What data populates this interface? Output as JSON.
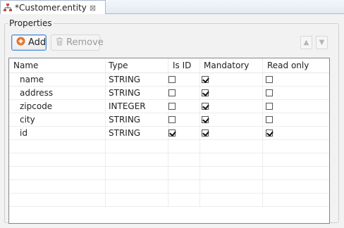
{
  "tab": {
    "title": "*Customer.entity",
    "icon": "entity-tree-icon",
    "close_glyph": "⊠"
  },
  "group": {
    "label": "Properties"
  },
  "toolbar": {
    "add_label": "Add",
    "remove_label": "Remove",
    "move_up_glyph": "▲",
    "move_down_glyph": "▼"
  },
  "table": {
    "columns": [
      "Name",
      "Type",
      "Is ID",
      "Mandatory",
      "Read only"
    ],
    "rows": [
      {
        "name": "name",
        "type": "STRING",
        "is_id": false,
        "mandatory": true,
        "read_only": false
      },
      {
        "name": "address",
        "type": "STRING",
        "is_id": false,
        "mandatory": true,
        "read_only": false
      },
      {
        "name": "zipcode",
        "type": "INTEGER",
        "is_id": false,
        "mandatory": true,
        "read_only": false
      },
      {
        "name": "city",
        "type": "STRING",
        "is_id": false,
        "mandatory": true,
        "read_only": false
      },
      {
        "name": "id",
        "type": "STRING",
        "is_id": true,
        "mandatory": true,
        "read_only": true
      }
    ],
    "empty_rows": 5
  },
  "colors": {
    "add_icon": "#e8732a",
    "focus_border": "#4a8bd6",
    "tab_icon": "#c2483c"
  }
}
